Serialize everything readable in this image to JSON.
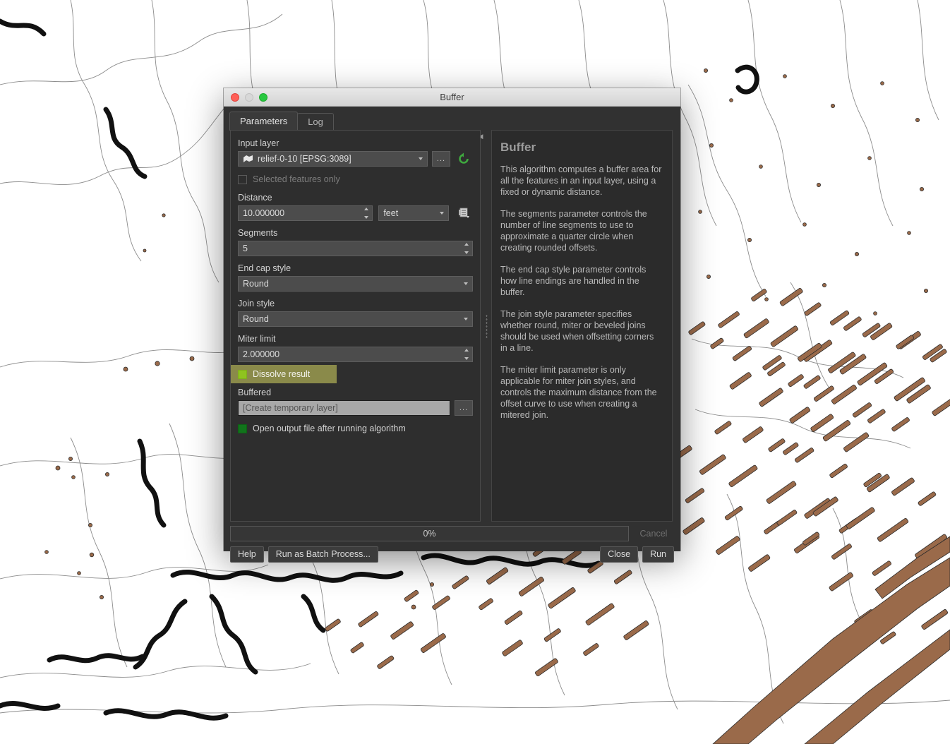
{
  "window": {
    "title": "Buffer",
    "controls": {
      "close": "close",
      "minimize": "minimize",
      "zoom": "zoom"
    }
  },
  "tabs": [
    {
      "label": "Parameters",
      "active": true
    },
    {
      "label": "Log",
      "active": false
    }
  ],
  "parameters": {
    "input_layer": {
      "label": "Input layer",
      "value": "relief-0-10 [EPSG:3089]",
      "browse_label": "...",
      "iterate_label": "↺"
    },
    "selected_features_only": {
      "label": "Selected features only",
      "checked": false,
      "enabled": false
    },
    "distance": {
      "label": "Distance",
      "value": "10.000000",
      "unit": "feet",
      "data_defined_label": "data-defined override"
    },
    "segments": {
      "label": "Segments",
      "value": "5"
    },
    "end_cap_style": {
      "label": "End cap style",
      "value": "Round"
    },
    "join_style": {
      "label": "Join style",
      "value": "Round"
    },
    "miter_limit": {
      "label": "Miter limit",
      "value": "2.000000"
    },
    "dissolve_result": {
      "label": "Dissolve result",
      "checked": true,
      "highlighted": true
    },
    "buffered": {
      "label": "Buffered",
      "value": "[Create temporary layer]",
      "browse_label": "..."
    },
    "open_output": {
      "label": "Open output file after running algorithm",
      "checked": true
    }
  },
  "help": {
    "title": "Buffer",
    "paragraphs": [
      "This algorithm computes a buffer area for all the features in an input layer, using a fixed or dynamic distance.",
      "The segments parameter controls the number of line segments to use to approximate a quarter circle when creating rounded offsets.",
      "The end cap style parameter controls how line endings are handled in the buffer.",
      "The join style parameter specifies whether round, miter or beveled joins should be used when offsetting corners in a line.",
      "The miter limit parameter is only applicable for miter join styles, and controls the maximum distance from the offset curve to use when creating a mitered join."
    ]
  },
  "progress": {
    "percent_label": "0%",
    "cancel_label": "Cancel"
  },
  "buttons": {
    "help": "Help",
    "batch": "Run as Batch Process...",
    "close": "Close",
    "run": "Run"
  },
  "colors": {
    "highlight": "#8a8a4a",
    "checkbox_bright": "#8fc31f",
    "checkbox_green": "#11741b",
    "refresh_green": "#3fa83f",
    "map_polygon_brown": "#9a6a4a",
    "map_line_gray": "#8c8c8c",
    "map_line_black": "#111111",
    "dialog_bg": "#313131",
    "panel_bg": "#2e2e2e"
  },
  "map": {
    "layer_polygon_fill": "#9a6a4a",
    "layer_polygon_stroke": "#2b2b2b",
    "layer_contour_stroke": "#8c8c8c",
    "layer_hydro_stroke": "#111111",
    "background": "#ffffff"
  }
}
